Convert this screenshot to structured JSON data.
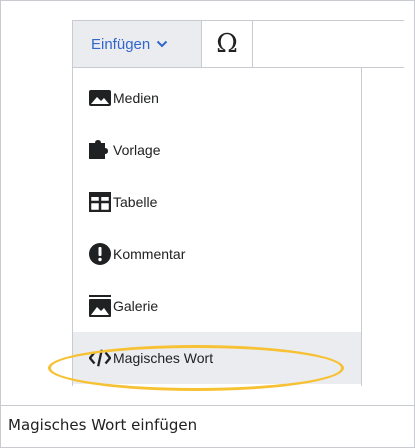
{
  "toolbar": {
    "insert_label": "Einfügen",
    "special_chars_symbol": "Ω"
  },
  "menu": {
    "items": [
      {
        "label": "Medien",
        "icon": "image-icon"
      },
      {
        "label": "Vorlage",
        "icon": "puzzle-icon"
      },
      {
        "label": "Tabelle",
        "icon": "table-icon"
      },
      {
        "label": "Kommentar",
        "icon": "exclamation-icon"
      },
      {
        "label": "Galerie",
        "icon": "gallery-icon"
      },
      {
        "label": "Magisches Wort",
        "icon": "code-icon"
      }
    ],
    "highlighted": "Magisches Wort"
  },
  "caption": "Magisches Wort einfügen",
  "colors": {
    "link": "#3366cc",
    "highlight_ring": "#f7c134",
    "hover_bg": "#eaecf0",
    "border": "#c8ccd1"
  }
}
